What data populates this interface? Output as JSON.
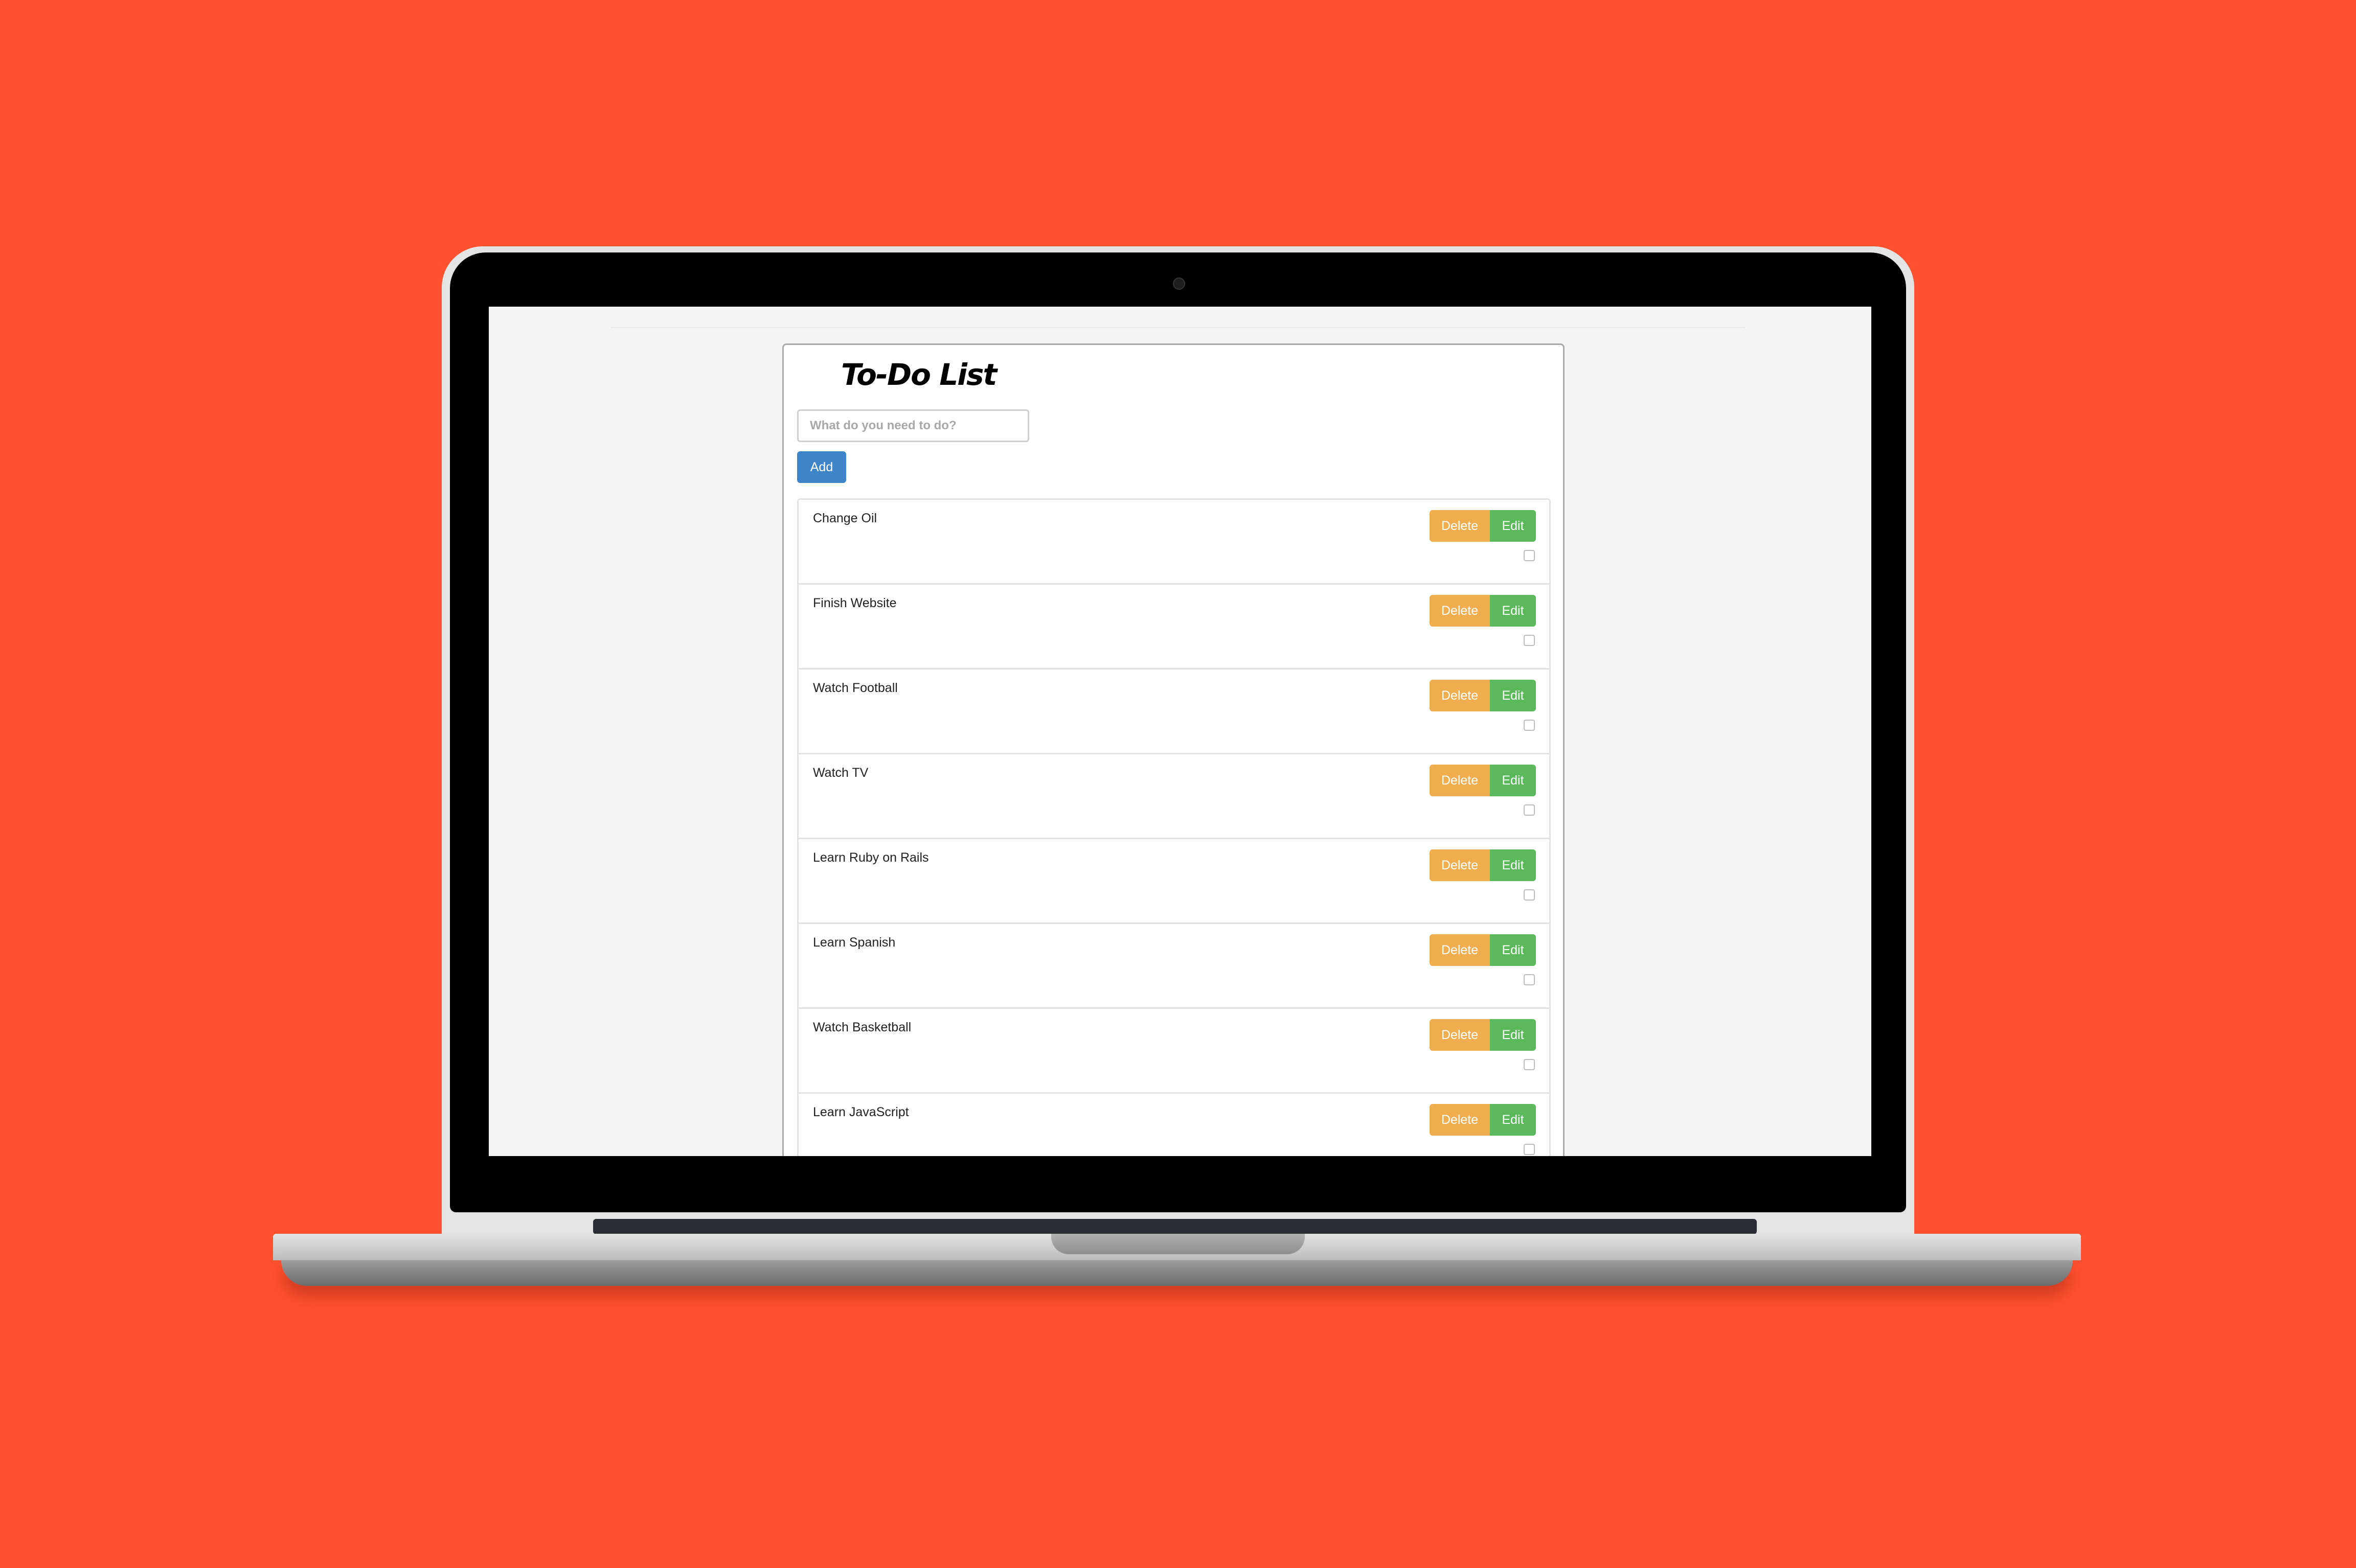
{
  "app": {
    "title": "To-Do List"
  },
  "form": {
    "placeholder": "What do you need to do?",
    "value": "",
    "add_label": "Add"
  },
  "tasks": [
    {
      "label": "Change Oil",
      "delete_label": "Delete",
      "edit_label": "Edit",
      "done": false
    },
    {
      "label": "Finish Website",
      "delete_label": "Delete",
      "edit_label": "Edit",
      "done": false
    },
    {
      "label": "Watch Football",
      "delete_label": "Delete",
      "edit_label": "Edit",
      "done": false
    },
    {
      "label": "Watch TV",
      "delete_label": "Delete",
      "edit_label": "Edit",
      "done": false
    },
    {
      "label": "Learn Ruby on Rails",
      "delete_label": "Delete",
      "edit_label": "Edit",
      "done": false
    },
    {
      "label": "Learn Spanish",
      "delete_label": "Delete",
      "edit_label": "Edit",
      "done": false
    },
    {
      "label": "Watch Basketball",
      "delete_label": "Delete",
      "edit_label": "Edit",
      "done": false
    },
    {
      "label": "Learn JavaScript",
      "delete_label": "Delete",
      "edit_label": "Edit",
      "done": false
    }
  ],
  "colors": {
    "background": "#ff5130",
    "add_button": "#3d84c8",
    "delete_button": "#efad4e",
    "edit_button": "#5bb85b"
  }
}
